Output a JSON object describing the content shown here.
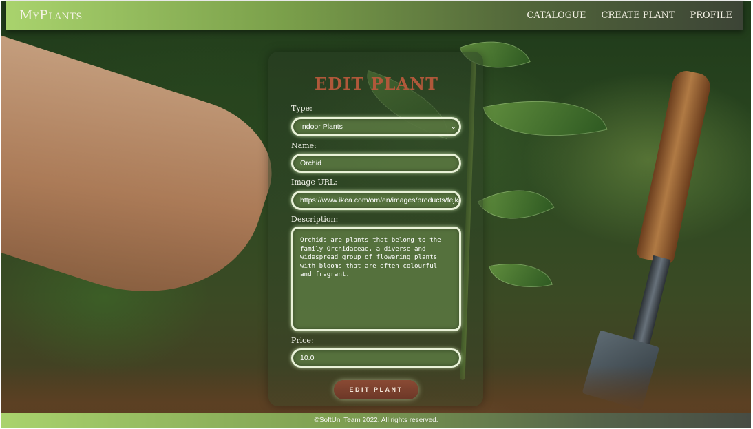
{
  "header": {
    "logo": "MyPlants",
    "nav": [
      "CATALOGUE",
      "CREATE PLANT",
      "PROFILE"
    ]
  },
  "form": {
    "title": "EDIT PLANT",
    "type_label": "Type:",
    "type_value": "Indoor Plants",
    "name_label": "Name:",
    "name_value": "Orchid",
    "image_label": "Image URL:",
    "image_value": "https://www.ikea.com/om/en/images/products/fejka-a",
    "description_label": "Description:",
    "description_value": "Orchids are plants that belong to the family Orchidaceae, a diverse and widespread group of flowering plants with blooms that are often colourful and fragrant.",
    "price_label": "Price:",
    "price_value": "10.0",
    "submit_label": "EDIT PLANT"
  },
  "footer": {
    "text": "©SoftUni Team 2022. All rights reserved."
  },
  "colors": {
    "accent": "#b0583a",
    "header_green": "#a9d36d",
    "field_border": "#e9f2d8",
    "button": "#7a412e"
  }
}
